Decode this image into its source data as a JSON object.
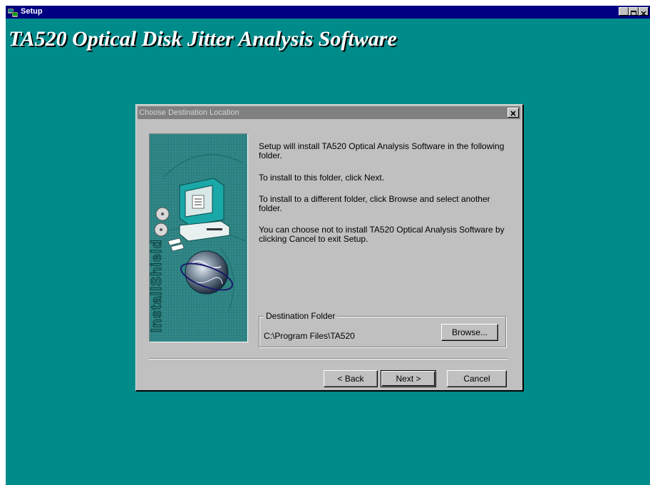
{
  "window": {
    "title": "Setup"
  },
  "banner": {
    "text": "TA520 Optical Disk Jitter Analysis Software"
  },
  "dialog": {
    "title": "Choose Destination Location",
    "paragraphs": [
      "Setup will install TA520 Optical Analysis Software in the following folder.",
      "To install to this folder, click Next.",
      "To install to a different folder, click Browse and select another folder.",
      "You can choose not to install TA520 Optical Analysis Software by clicking Cancel to exit Setup."
    ],
    "destination": {
      "label": "Destination Folder",
      "path": "C:\\Program Files\\TA520",
      "browse_label": "Browse..."
    },
    "image_text": "InstallShield",
    "buttons": {
      "back": "< Back",
      "next": "Next >",
      "cancel": "Cancel"
    }
  },
  "colors": {
    "desktop": "#008b8b",
    "titlebar": "#000080",
    "dialog_face": "#c0c0c0",
    "inactive_title": "#808080"
  },
  "icons": [
    "setup-app-icon",
    "minimize-icon",
    "maximize-icon",
    "close-icon",
    "computer-icon",
    "globe-icon",
    "disk-icon"
  ]
}
